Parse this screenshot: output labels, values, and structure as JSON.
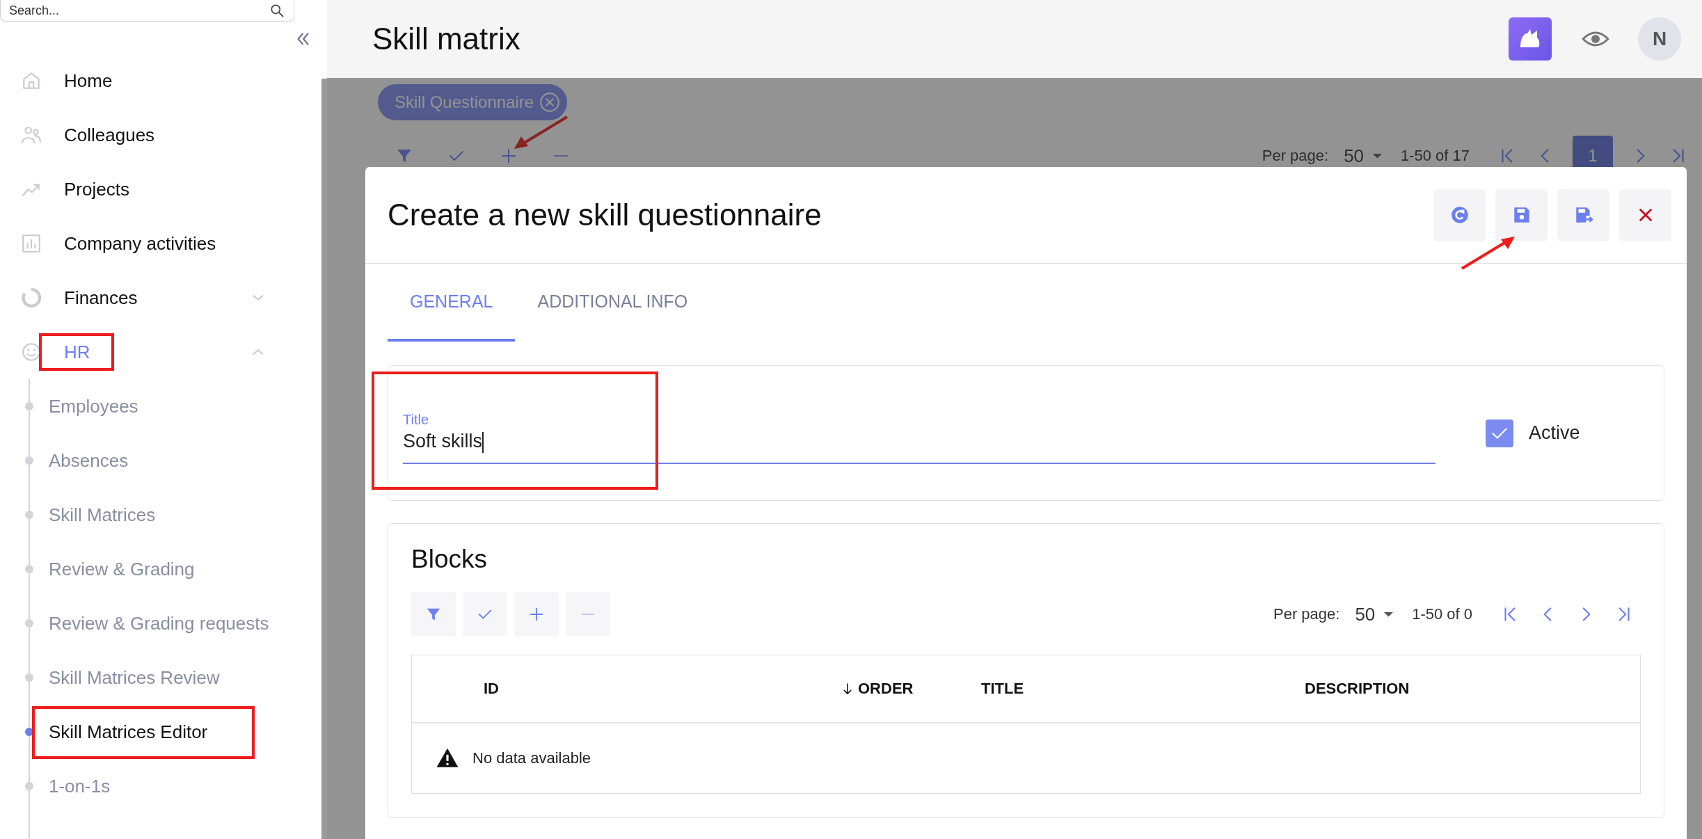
{
  "sidebar": {
    "search": {
      "placeholder": "Search..."
    },
    "items": [
      {
        "label": "Home",
        "kind": "home",
        "selected": false,
        "highlighted": false
      },
      {
        "label": "Colleagues",
        "kind": "people",
        "selected": false,
        "highlighted": false
      },
      {
        "label": "Projects",
        "kind": "trend",
        "selected": false,
        "highlighted": false
      },
      {
        "label": "Company activities",
        "kind": "chart",
        "selected": false,
        "highlighted": false
      },
      {
        "label": "Finances",
        "kind": "donut",
        "selected": false,
        "highlighted": false,
        "expanded": false
      },
      {
        "label": "HR",
        "kind": "smiley",
        "selected": true,
        "highlighted": true,
        "expanded": true,
        "children": [
          {
            "label": "Employees",
            "selected": false,
            "highlighted": false
          },
          {
            "label": "Absences",
            "selected": false,
            "highlighted": false
          },
          {
            "label": "Skill Matrices",
            "selected": false,
            "highlighted": false
          },
          {
            "label": "Review & Grading",
            "selected": false,
            "highlighted": false
          },
          {
            "label": "Review & Grading requests",
            "selected": false,
            "highlighted": false
          },
          {
            "label": "Skill Matrices Review",
            "selected": false,
            "highlighted": false
          },
          {
            "label": "Skill Matrices Editor",
            "selected": true,
            "highlighted": true
          },
          {
            "label": "1-on-1s",
            "selected": false,
            "highlighted": false
          }
        ]
      }
    ]
  },
  "header": {
    "title": "Skill matrix",
    "avatar": "N"
  },
  "background": {
    "chip": {
      "label": "Skill Questionnaire"
    },
    "toolbar": [
      {
        "kind": "filter",
        "pointed": false
      },
      {
        "kind": "check",
        "pointed": false
      },
      {
        "kind": "add",
        "pointed": true
      },
      {
        "kind": "remove",
        "pointed": false
      }
    ],
    "pagination": {
      "per_page_label": "Per page:",
      "per_page": "50",
      "range": "1-50 of 17",
      "pages": [
        {
          "label": "1",
          "selected": true
        }
      ]
    }
  },
  "dialog": {
    "title": "Create a new skill questionnaire",
    "actions": [
      {
        "kind": "refresh",
        "pointed": false
      },
      {
        "kind": "save",
        "pointed": true
      },
      {
        "kind": "save-next",
        "pointed": false
      },
      {
        "kind": "close",
        "pointed": false
      }
    ],
    "tabs": [
      {
        "label": "GENERAL",
        "selected": true
      },
      {
        "label": "ADDITIONAL INFO",
        "selected": false
      }
    ],
    "title_field": {
      "label": "Title",
      "value": "Soft skills",
      "highlighted": true
    },
    "active": {
      "label": "Active",
      "checked": true
    },
    "blocks": {
      "title": "Blocks",
      "toolbar": [
        {
          "kind": "filter"
        },
        {
          "kind": "check"
        },
        {
          "kind": "add"
        },
        {
          "kind": "remove"
        }
      ],
      "pagination": {
        "per_page_label": "Per page:",
        "per_page": "50",
        "range": "1-50 of 0"
      },
      "table": {
        "columns": [
          {
            "label": "ID",
            "sorted": false
          },
          {
            "label": "ORDER",
            "sorted": true
          },
          {
            "label": "TITLE",
            "sorted": false
          },
          {
            "label": "DESCRIPTION",
            "sorted": false
          }
        ],
        "empty": "No data available"
      }
    }
  }
}
